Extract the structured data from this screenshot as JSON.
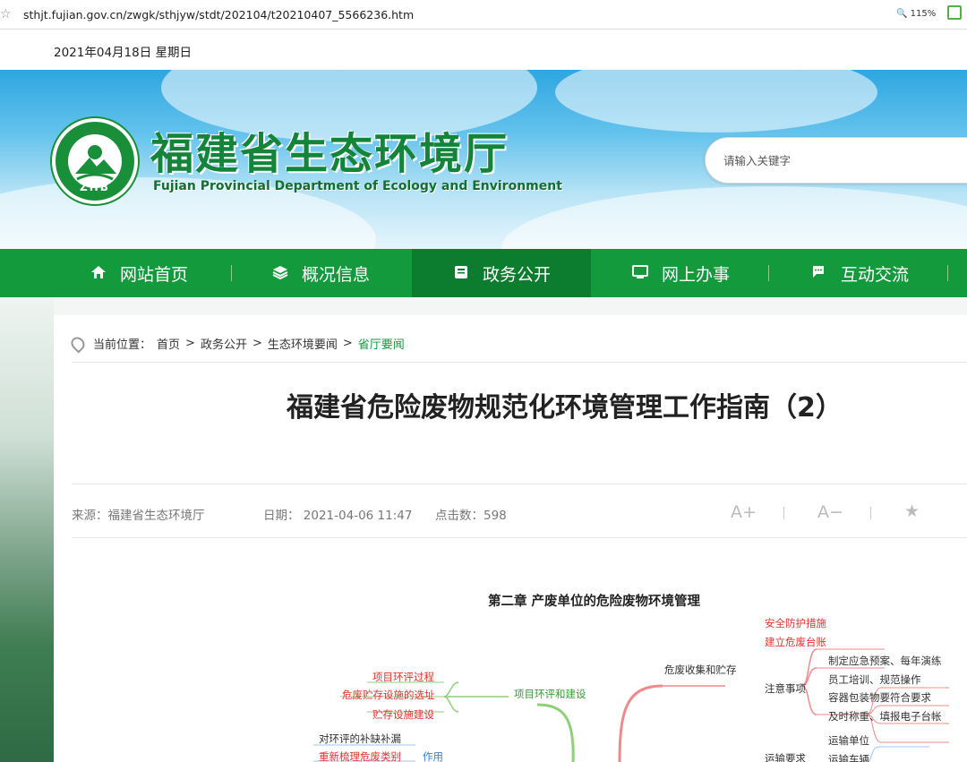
{
  "browser": {
    "url": "sthjt.fujian.gov.cn/zwgk/sthjyw/stdt/202104/t20210407_5566236.htm",
    "zoom": "115%"
  },
  "topbar": {
    "date": "2021年04月18日  星期日"
  },
  "header": {
    "logo_text": "ZHB",
    "site_name_cn": "福建省生态环境厅",
    "site_name_en": "Fujian Provincial Department of Ecology and Environment",
    "search_placeholder": "请输入关键字"
  },
  "nav": {
    "items": [
      {
        "label": "网站首页",
        "icon": "home-icon"
      },
      {
        "label": "概况信息",
        "icon": "layers-icon"
      },
      {
        "label": "政务公开",
        "icon": "document-icon",
        "active": true
      },
      {
        "label": "网上办事",
        "icon": "monitor-icon"
      },
      {
        "label": "互动交流",
        "icon": "chat-icon"
      }
    ]
  },
  "breadcrumb": {
    "prefix": "当前位置：",
    "items": [
      "首页",
      "政务公开",
      "生态环境要闻"
    ],
    "current": "省厅要闻",
    "sep": ">"
  },
  "article": {
    "title": "福建省危险废物规范化环境管理工作指南（2）",
    "source": "来源：福建省生态环境厅",
    "date": "日期： 2021-04-06 11:47",
    "clicks": "点击数：598",
    "font_increase": "A+",
    "font_decrease": "A−"
  },
  "mindmap": {
    "title": "第二章 产废单位的危险废物环境管理",
    "left": {
      "branch": "项目环评和建设",
      "children": [
        "项目环评过程",
        "危废贮存设施的选址",
        "贮存设施建设"
      ]
    },
    "left2": {
      "branch": "作用",
      "children": [
        "对环评的补缺补漏",
        "重新梳理危废类别"
      ]
    },
    "right": {
      "branch": "危废收集和贮存",
      "children": [
        "安全防护措施",
        "建立危废台账"
      ],
      "notes_branch": "注意事项",
      "notes": [
        "制定应急预案、每年演练",
        "员工培训、规范操作",
        "容器包装物要符合要求",
        "及时称重、填报电子台帐"
      ]
    },
    "transport": {
      "branch": "运输要求",
      "children": [
        "运输单位",
        "运输车辆"
      ]
    }
  },
  "colors": {
    "brand_green": "#139a3d",
    "nav_active": "#0c7c2e",
    "accent_red": "#e0332f"
  }
}
